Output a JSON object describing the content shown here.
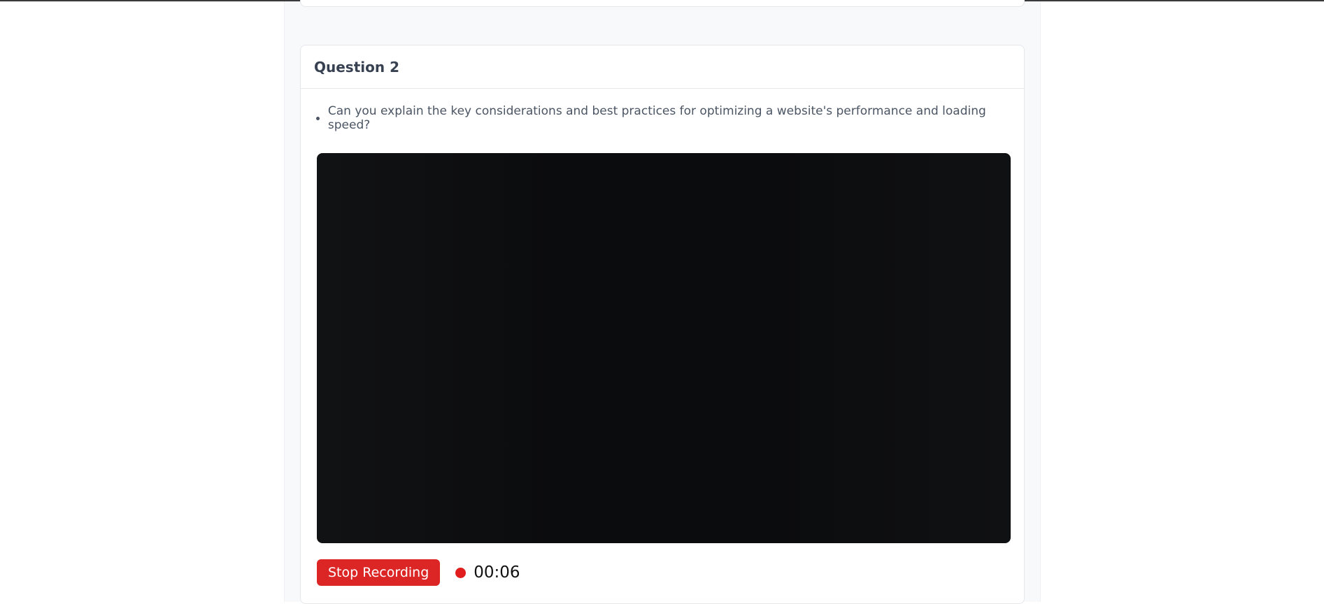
{
  "question": {
    "title": "Question 2",
    "items": [
      "Can you explain the key considerations and best practices for optimizing a website's performance and loading speed?"
    ]
  },
  "recording": {
    "stop_label": "Stop Recording",
    "elapsed": "00:06",
    "indicator_color": "#e11d1d",
    "button_color": "#dc2626"
  }
}
